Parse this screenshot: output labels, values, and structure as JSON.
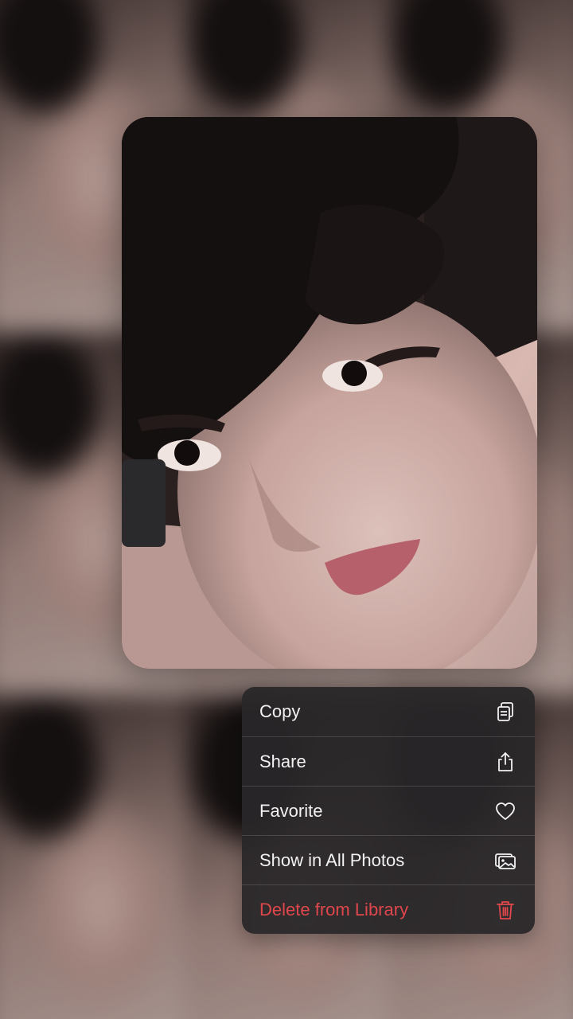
{
  "menu": {
    "items": [
      {
        "label": "Copy",
        "icon": "copy-icon"
      },
      {
        "label": "Share",
        "icon": "share-icon"
      },
      {
        "label": "Favorite",
        "icon": "heart-icon"
      },
      {
        "label": "Show in All Photos",
        "icon": "photos-icon"
      },
      {
        "label": "Delete from Library",
        "icon": "trash-icon"
      }
    ],
    "colors": {
      "text": "#f2f2f2",
      "destructive": "#e0474c",
      "background": "#282628"
    }
  }
}
